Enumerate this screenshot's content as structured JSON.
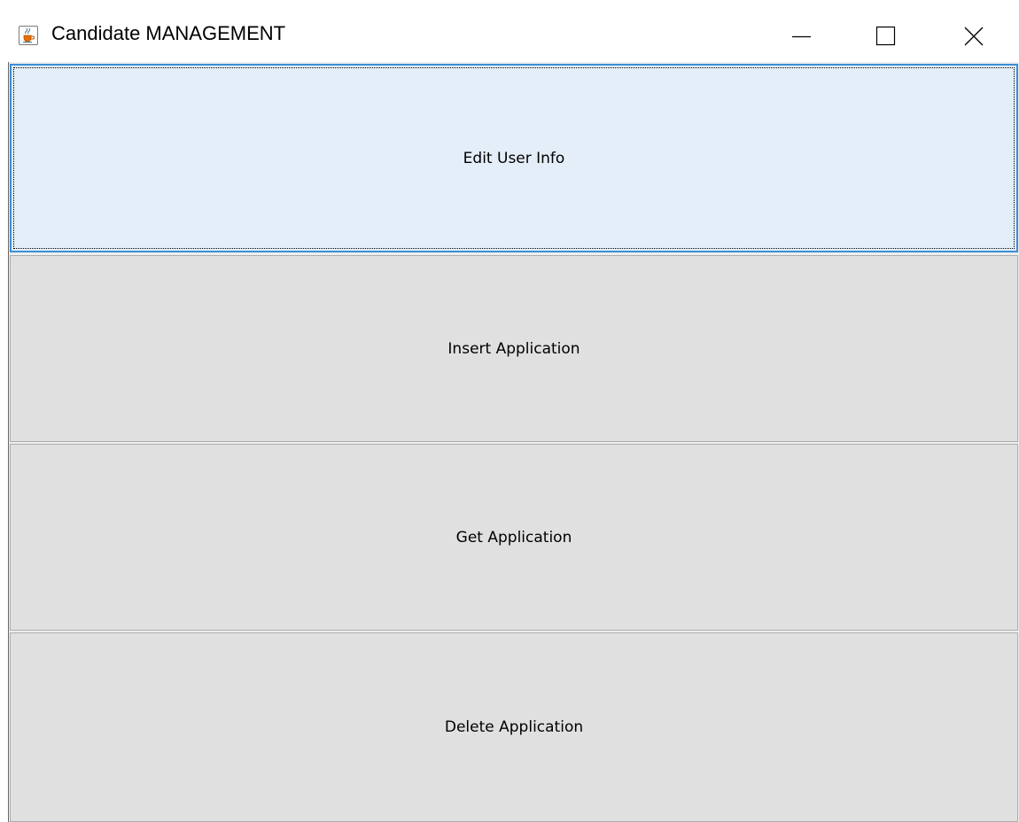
{
  "window": {
    "title": "Candidate MANAGEMENT",
    "app_icon": "java-cup-icon",
    "controls": {
      "minimize": "minimize-icon",
      "maximize": "maximize-icon",
      "close": "close-icon"
    }
  },
  "menu": {
    "buttons": [
      {
        "label": "Edit User Info",
        "focused": true
      },
      {
        "label": "Insert Application",
        "focused": false
      },
      {
        "label": "Get Application",
        "focused": false
      },
      {
        "label": "Delete Application",
        "focused": false
      }
    ]
  },
  "colors": {
    "button_face": "#e0e0e0",
    "focused_face": "#e4eef8",
    "focus_border": "#3c8fd6"
  }
}
